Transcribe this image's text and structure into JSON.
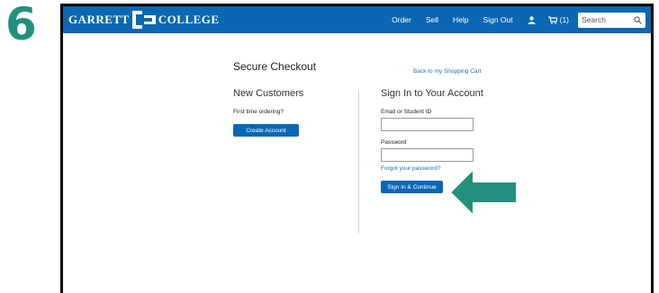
{
  "step": "6",
  "header": {
    "logo_left": "GARRETT",
    "logo_right": "COLLEGE",
    "nav": [
      "Order",
      "Sell",
      "Help",
      "Sign Out"
    ],
    "cart_count": "(1)",
    "search_placeholder": "Search"
  },
  "checkout": {
    "title": "Secure Checkout",
    "back_link": "Back to my Shopping Cart",
    "new_customers": {
      "heading": "New Customers",
      "prompt": "First time ordering?",
      "button": "Create Account"
    },
    "sign_in": {
      "heading": "Sign In to Your Account",
      "email_label": "Email or Student ID",
      "email_value": "",
      "password_label": "Password",
      "password_value": "",
      "forgot_link": "Forgot your password?",
      "button": "Sign In & Continue"
    }
  },
  "colors": {
    "brand_blue": "#0a67b3",
    "step_teal": "#23907e",
    "arrow_teal": "#23907e",
    "link": "#1a6fbf"
  },
  "icons": {
    "user": "user-icon",
    "cart": "cart-icon",
    "search": "search-icon",
    "arrow": "arrow-left-icon"
  }
}
